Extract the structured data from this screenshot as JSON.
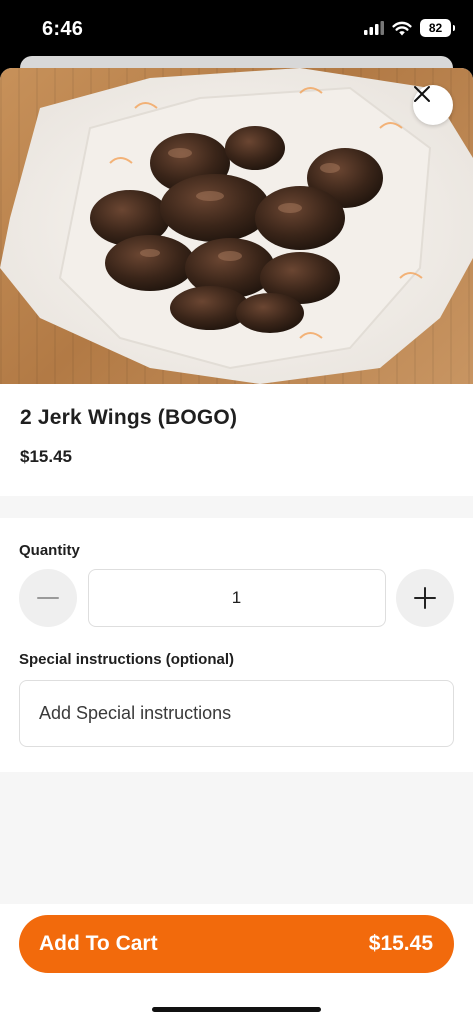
{
  "status_bar": {
    "time": "6:46",
    "battery": "82"
  },
  "product": {
    "title": "2 Jerk Wings (BOGO)",
    "price": "$15.45"
  },
  "quantity": {
    "label": "Quantity",
    "value": "1"
  },
  "instructions": {
    "label": "Special instructions (optional)",
    "placeholder": "Add Special instructions"
  },
  "cart": {
    "label": "Add To Cart",
    "price": "$15.45"
  },
  "colors": {
    "accent": "#f26a0c",
    "field_border": "#dedede",
    "band": "#f6f6f6"
  },
  "icons": {
    "close": "close-icon",
    "minus": "minus-icon",
    "plus": "plus-icon",
    "signal": "signal-icon",
    "wifi": "wifi-icon"
  }
}
